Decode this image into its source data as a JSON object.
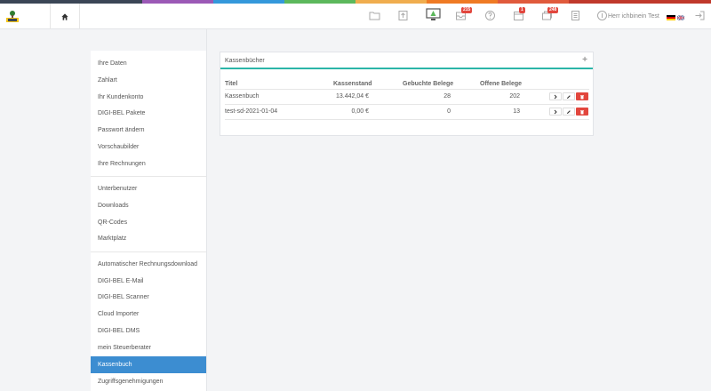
{
  "colors": {
    "bar": [
      "#3b4656",
      "#3b4656",
      "#9b59b6",
      "#3498db",
      "#5cb85c",
      "#f0ad4e",
      "#ef7a24",
      "#e05a3c",
      "#c0392b",
      "#c0392b"
    ],
    "accent": "#3c8dd1",
    "teal": "#2cb5a8",
    "danger": "#e2463d"
  },
  "header": {
    "logo": "digi-bel-logo",
    "home_icon": "home-icon",
    "user_name": "Herr ichbinein Test",
    "badges": {
      "inbox": "215",
      "calendar": "1",
      "messages": "248"
    },
    "flags": [
      "german-flag",
      "uk-flag"
    ]
  },
  "sidebar": {
    "items": [
      "Ihre Daten",
      "Zahlart",
      "Ihr Kundenkonto",
      "DIGI-BEL Pakete",
      "Passwort ändern",
      "Vorschaubilder",
      "Ihre Rechnungen",
      "Unterbenutzer",
      "Downloads",
      "QR-Codes",
      "Marktplatz",
      "Automatischer Rechnungsdownload",
      "DIGI-BEL E-Mail",
      "DIGI-BEL Scanner",
      "Cloud Importer",
      "DIGI-BEL DMS",
      "mein Steuerberater",
      "Kassenbuch",
      "Zugriffsgenehmigungen"
    ],
    "active": "Kassenbuch"
  },
  "card": {
    "title": "Kassenbücher",
    "add": "+",
    "columns": [
      "Titel",
      "Kassenstand",
      "Gebuchte Belege",
      "Offene Belege"
    ],
    "rows": [
      {
        "title": "Kassenbuch",
        "balance": "13.442,04 €",
        "booked": "28",
        "open": "202"
      },
      {
        "title": "test-sd-2021-01-04",
        "balance": "0,00 €",
        "booked": "0",
        "open": "13"
      }
    ]
  }
}
